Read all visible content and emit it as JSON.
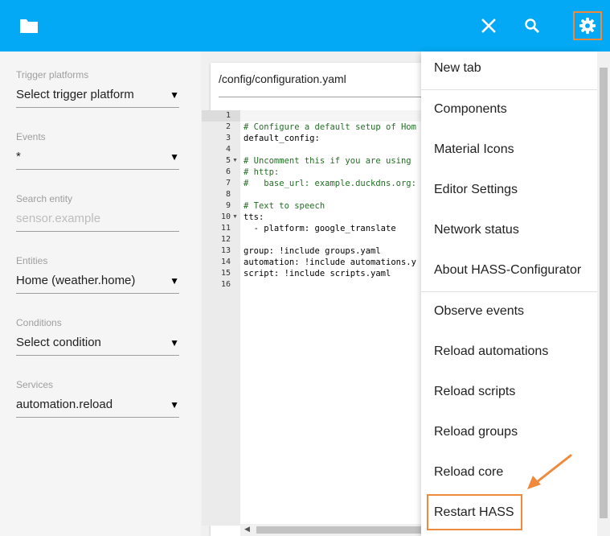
{
  "sidebar": {
    "trigger_platforms": {
      "label": "Trigger platforms",
      "value": "Select trigger platform"
    },
    "events": {
      "label": "Events",
      "value": "*"
    },
    "search_entity": {
      "label": "Search entity",
      "placeholder": "sensor.example"
    },
    "entities": {
      "label": "Entities",
      "value": "Home (weather.home)"
    },
    "conditions": {
      "label": "Conditions",
      "value": "Select condition"
    },
    "services": {
      "label": "Services",
      "value": "automation.reload"
    }
  },
  "editor": {
    "filename": "/config/configuration.yaml",
    "lines": [
      {
        "n": "1",
        "text": ""
      },
      {
        "n": "2",
        "text": "# Configure a default setup of Hom"
      },
      {
        "n": "3",
        "text": "default_config:"
      },
      {
        "n": "4",
        "text": ""
      },
      {
        "n": "5",
        "text": "# Uncomment this if you are using"
      },
      {
        "n": "6",
        "text": "# http:"
      },
      {
        "n": "7",
        "text": "#   base_url: example.duckdns.org:"
      },
      {
        "n": "8",
        "text": ""
      },
      {
        "n": "9",
        "text": "# Text to speech"
      },
      {
        "n": "10",
        "text": "tts:"
      },
      {
        "n": "11",
        "text": "  - platform: google_translate"
      },
      {
        "n": "12",
        "text": ""
      },
      {
        "n": "13",
        "text": "group: !include groups.yaml"
      },
      {
        "n": "14",
        "text": "automation: !include automations.y"
      },
      {
        "n": "15",
        "text": "script: !include scripts.yaml"
      },
      {
        "n": "16",
        "text": ""
      }
    ]
  },
  "menu": {
    "items": [
      {
        "label": "New tab"
      },
      {
        "label": "Components"
      },
      {
        "label": "Material Icons"
      },
      {
        "label": "Editor Settings"
      },
      {
        "label": "Network status"
      },
      {
        "label": "About HASS-Configurator"
      },
      {
        "label": "Observe events"
      },
      {
        "label": "Reload automations"
      },
      {
        "label": "Reload scripts"
      },
      {
        "label": "Reload groups"
      },
      {
        "label": "Reload core"
      },
      {
        "label": "Restart HASS"
      }
    ]
  },
  "icons": {
    "folder": "folder-icon",
    "close": "close-icon",
    "search": "search-icon",
    "settings": "gear-icon"
  },
  "colors": {
    "header": "#03a9f4",
    "highlight": "#ef8a3c",
    "comment": "#236e24"
  }
}
